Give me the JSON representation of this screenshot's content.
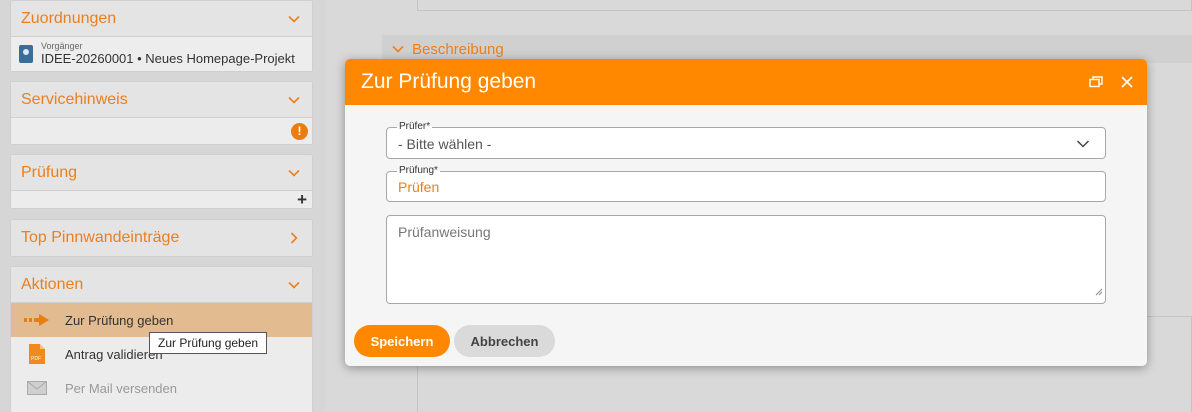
{
  "sidebar": {
    "assignments": {
      "title": "Zuordnungen",
      "predecessor_label": "Vorgänger",
      "predecessor_value": "IDEE-20260001 • Neues Homepage-Projekt"
    },
    "service": {
      "title": "Servicehinweis",
      "badge": "!"
    },
    "review": {
      "title": "Prüfung",
      "add": "+"
    },
    "pinboard": {
      "title": "Top Pinnwandeinträge"
    },
    "actions": {
      "title": "Aktionen",
      "items": [
        {
          "label": "Zur Prüfung geben",
          "icon": "arrow-right-icon"
        },
        {
          "label": "Antrag validieren",
          "icon": "pdf-icon"
        },
        {
          "label": "Per Mail versenden",
          "icon": "mail-icon"
        }
      ]
    },
    "tooltip": "Zur Prüfung geben"
  },
  "background": {
    "section_title": "Beschreibung"
  },
  "modal": {
    "title": "Zur Prüfung geben",
    "fields": {
      "reviewer": {
        "label": "Prüfer*",
        "value": "- Bitte wählen -"
      },
      "review": {
        "label": "Prüfung*",
        "value": "Prüfen"
      },
      "instruction": {
        "placeholder": "Prüfanweisung"
      }
    },
    "buttons": {
      "save": "Speichern",
      "cancel": "Abbrechen"
    }
  },
  "colors": {
    "accent": "#ff8800",
    "title_orange": "#ec7f1c"
  }
}
